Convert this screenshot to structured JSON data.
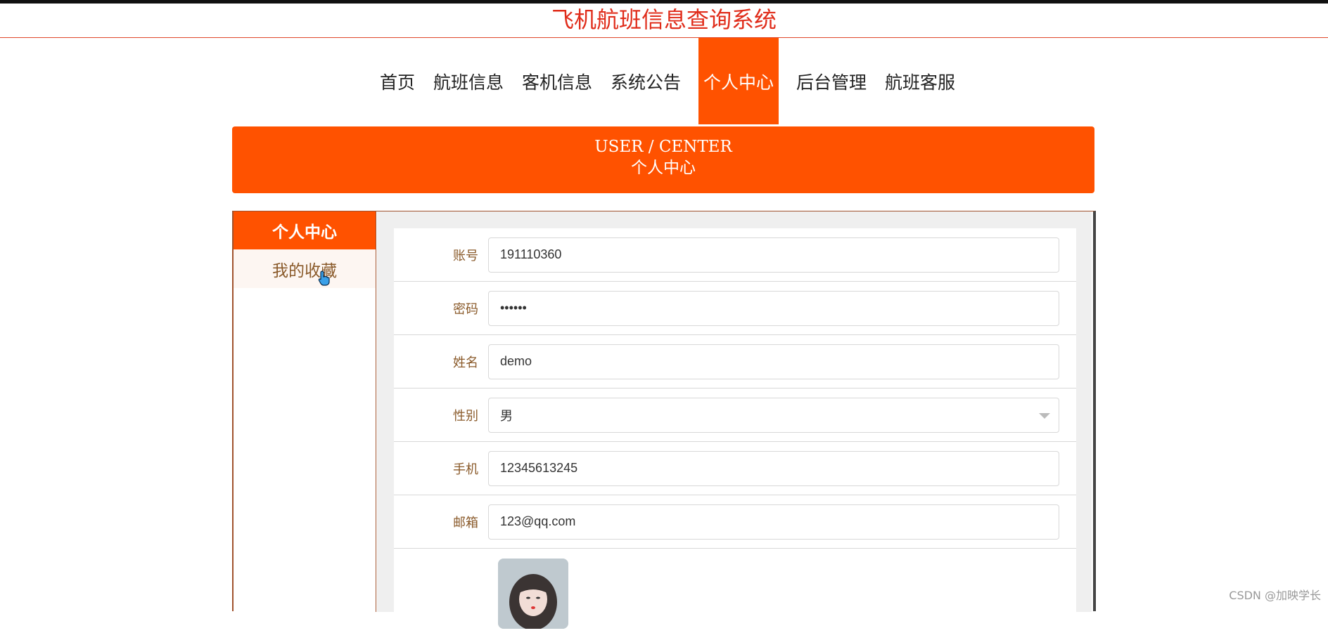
{
  "site": {
    "title": "飞机航班信息查询系统"
  },
  "nav": {
    "items": [
      {
        "label": "首页",
        "name": "nav-home"
      },
      {
        "label": "航班信息",
        "name": "nav-flight-info"
      },
      {
        "label": "客机信息",
        "name": "nav-aircraft-info"
      },
      {
        "label": "系统公告",
        "name": "nav-announcements"
      },
      {
        "label": "个人中心",
        "name": "nav-user-center"
      },
      {
        "label": "后台管理",
        "name": "nav-admin"
      },
      {
        "label": "航班客服",
        "name": "nav-customer-service"
      }
    ],
    "active": "个人中心"
  },
  "banner": {
    "title_en": "USER / CENTER",
    "title_zh": "个人中心"
  },
  "sidebar": {
    "items": [
      {
        "label": "个人中心",
        "active": true
      },
      {
        "label": "我的收藏",
        "active": false
      }
    ]
  },
  "form": {
    "account_label": "账号",
    "account_value": "191110360",
    "password_label": "密码",
    "password_value": "••••••",
    "name_label": "姓名",
    "name_value": "demo",
    "gender_label": "性别",
    "gender_value": "男",
    "phone_label": "手机",
    "phone_value": "12345613245",
    "email_label": "邮箱",
    "email_value": "123@qq.com"
  },
  "watermark": "CSDN @加映学长",
  "colors": {
    "accent": "#ff5200",
    "title_red": "#e02c1a",
    "label_brown": "#8a5a2a",
    "cursor": "hand-pointer-icon"
  }
}
